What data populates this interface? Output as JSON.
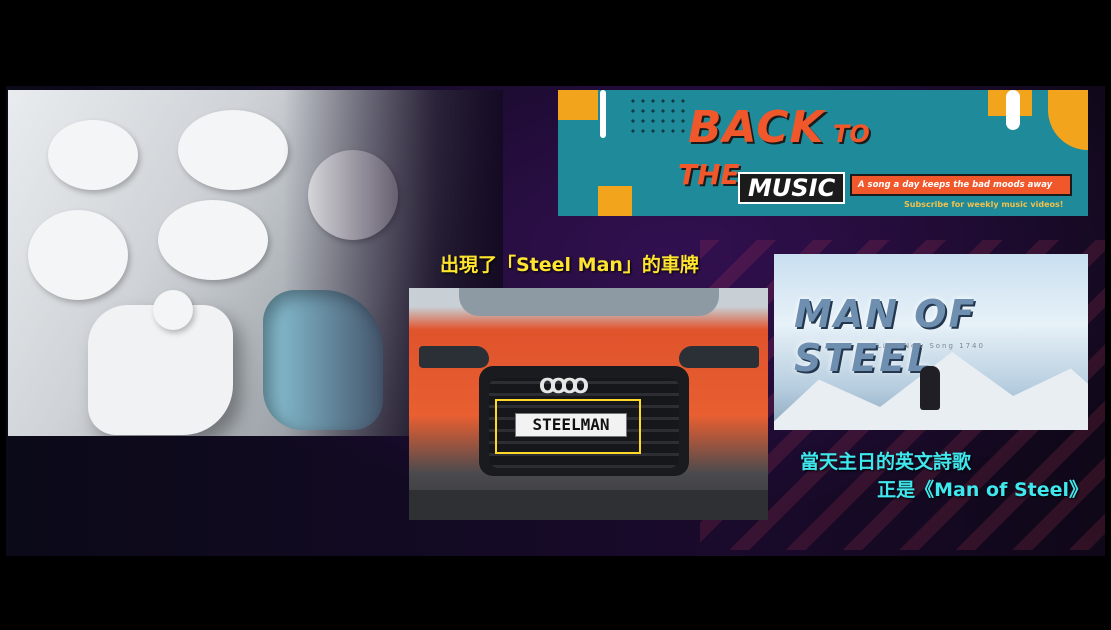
{
  "banner": {
    "word_back": "BACK",
    "word_to": "TO",
    "word_the": "THE",
    "word_music": "MUSIC",
    "tagline": "A song a day keeps the bad moods away",
    "subscribe": "Subscribe for weekly music videos!"
  },
  "captions": {
    "plate_caption": "出現了「Steel Man」的車牌",
    "hymn_line1": "當天主日的英文詩歌",
    "hymn_line2": "正是《Man of Steel》"
  },
  "car": {
    "plate_text": "STEELMAN",
    "logo_rings": "OOOO"
  },
  "poster": {
    "title": "MAN OF STEEL",
    "subtitle": "Lion New Song 1740"
  },
  "colors": {
    "caption_yellow": "#ffe430",
    "caption_cyan": "#3fe8ee",
    "banner_teal": "#1f8a9a",
    "banner_orange": "#f0572a",
    "highlight_box": "#ffd82a"
  }
}
